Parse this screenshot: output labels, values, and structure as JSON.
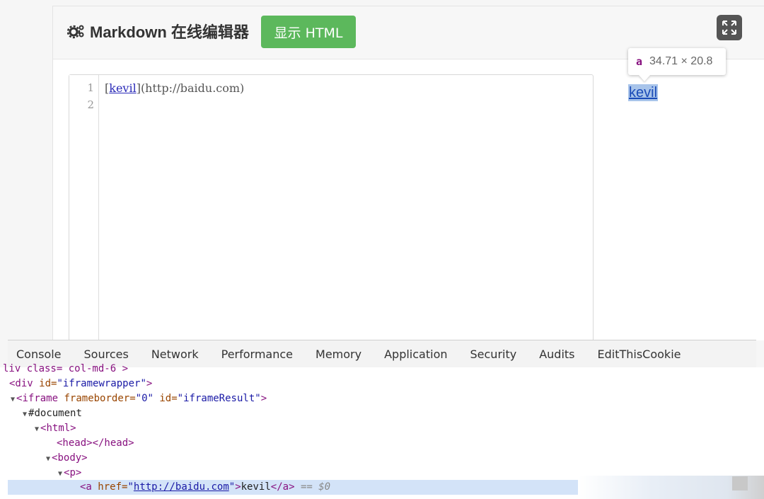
{
  "header": {
    "title": "Markdown 在线编辑器",
    "show_html_label": "显示 HTML"
  },
  "editor": {
    "line_numbers": [
      "1",
      "2"
    ],
    "line1": {
      "open_bracket": "[",
      "link_text": "kevil",
      "close_bracket": "]",
      "url_part": "(http://baidu.com)"
    }
  },
  "preview": {
    "tooltip_tag": "a",
    "tooltip_size": "34.71 × 20.8",
    "link_text": "kevil"
  },
  "devtools": {
    "tabs": [
      "Console",
      "Sources",
      "Network",
      "Performance",
      "Memory",
      "Application",
      "Security",
      "Audits",
      "EditThisCookie"
    ],
    "tree": {
      "line0": "liv class= col-md-6 >",
      "line1_tag_open": "<div",
      "line1_attr": "id=",
      "line1_val": "\"iframewrapper\"",
      "line1_close": ">",
      "line2_tag": "<iframe",
      "line2_attr1": "frameborder=",
      "line2_val1": "\"0\"",
      "line2_attr2": "id=",
      "line2_val2": "\"iframeResult\"",
      "line2_close": ">",
      "line3": "#document",
      "line4": "<html>",
      "line5": "<head></head>",
      "line6": "<body>",
      "line7": "<p>",
      "line8_tag": "<a",
      "line8_attr": "href=",
      "line8_q1": "\"",
      "line8_link": "http://baidu.com",
      "line8_q2": "\"",
      "line8_gt": ">",
      "line8_text": "kevil",
      "line8_end": "</a>",
      "line8_dollar": "== $0"
    }
  },
  "colors": {
    "button_green": "#5cb85c",
    "selection_blue": "#d3e3f8",
    "tag_purple": "#881280"
  }
}
